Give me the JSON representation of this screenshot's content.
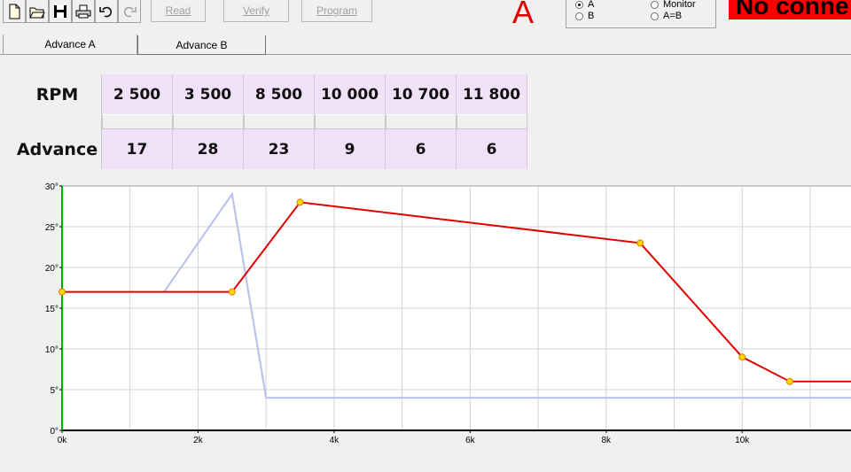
{
  "toolbar": {
    "icons": [
      "new-file-icon",
      "open-folder-icon",
      "save-icon",
      "print-icon",
      "undo-icon",
      "redo-icon"
    ],
    "read_label": "Read",
    "verify_label": "Verify",
    "program_label": "Program",
    "active_map": "A",
    "radios": [
      {
        "label": "A",
        "selected": true
      },
      {
        "label": "Monitor",
        "selected": false
      },
      {
        "label": "B",
        "selected": false
      },
      {
        "label": "A=B",
        "selected": false
      }
    ],
    "status_text": "No conne"
  },
  "tabs": [
    {
      "label": "Advance A",
      "active": true
    },
    {
      "label": "Advance B",
      "active": false
    }
  ],
  "table": {
    "row1_header": "RPM",
    "row2_header": "Advance",
    "rpm": [
      "2 500",
      "3 500",
      "8 500",
      "10 000",
      "10 700",
      "11 800"
    ],
    "advance": [
      "17",
      "28",
      "23",
      "9",
      "6",
      "6"
    ]
  },
  "chart_data": {
    "type": "line",
    "x_ticks": [
      "0k",
      "2k",
      "4k",
      "6k",
      "8k",
      "10k"
    ],
    "y_ticks": [
      "0°",
      "5°",
      "10°",
      "15°",
      "20°",
      "25°",
      "30°"
    ],
    "xlim": [
      0,
      11800
    ],
    "ylim": [
      0,
      30
    ],
    "grid": true,
    "series": [
      {
        "color": "#e00000",
        "x": [
          0,
          2500,
          3500,
          8500,
          10000,
          10700,
          11800
        ],
        "y": [
          17,
          17,
          28,
          23,
          9,
          6,
          6
        ],
        "markers": [
          0,
          2500,
          3500,
          8500,
          10000,
          10700
        ]
      },
      {
        "color": "#b8bfec",
        "x": [
          1500,
          2500,
          3000,
          11800
        ],
        "y": [
          17,
          29,
          4,
          4
        ]
      }
    ],
    "colors": {
      "marker_fill": "#ffd400",
      "marker_stroke": "#e08000",
      "y_axis": "#00b000"
    }
  }
}
